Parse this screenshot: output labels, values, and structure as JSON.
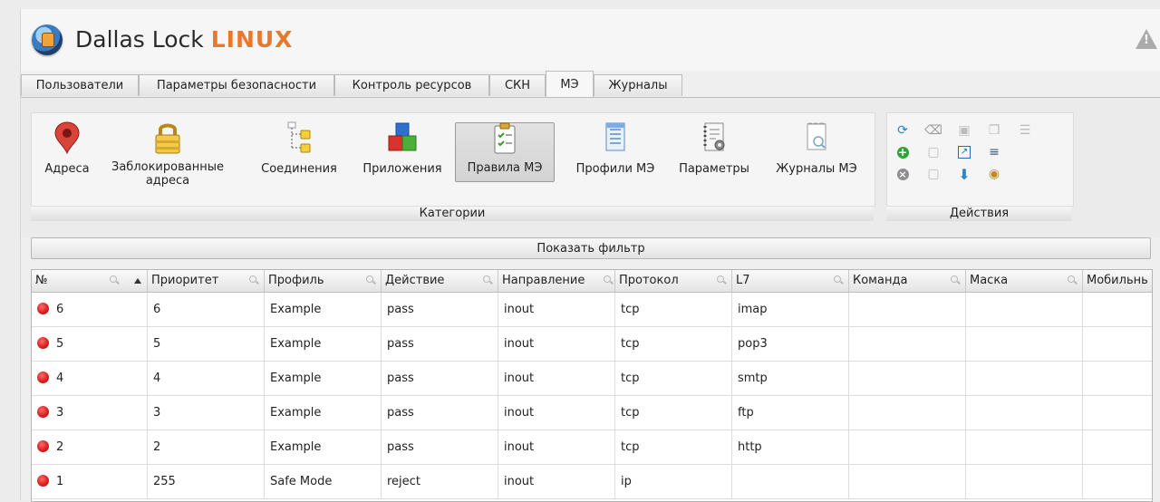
{
  "app": {
    "name_prefix": "Dallas Lock ",
    "name_accent": "LINUX"
  },
  "tabs": [
    "Пользователи",
    "Параметры безопасности",
    "Контроль ресурсов",
    "СКН",
    "МЭ",
    "Журналы"
  ],
  "active_tab": "МЭ",
  "categories": {
    "caption": "Категории",
    "items": [
      {
        "label": "Адреса",
        "icon": "map-pin-icon"
      },
      {
        "label": "Заблокированные адреса",
        "icon": "padlock-icon"
      },
      {
        "label": "Соединения",
        "icon": "tree-connections-icon"
      },
      {
        "label": "Приложения",
        "icon": "app-blocks-icon"
      },
      {
        "label": "Правила МЭ",
        "icon": "clipboard-check-icon"
      },
      {
        "label": "Профили МЭ",
        "icon": "document-icon"
      },
      {
        "label": "Параметры",
        "icon": "settings-notebook-icon"
      },
      {
        "label": "Журналы МЭ",
        "icon": "log-search-icon"
      }
    ],
    "active": "Правила МЭ"
  },
  "actions": {
    "caption": "Действия",
    "icons": [
      "refresh-icon",
      "backspace-icon",
      "save-icon",
      "copy-icon",
      "indent-icon",
      "add-icon",
      "paste-icon",
      "open-link-icon",
      "list-icon",
      "delete-icon",
      "page-icon",
      "move-down-icon",
      "view-icon"
    ]
  },
  "filter_button": "Показать фильтр",
  "table": {
    "columns": [
      "№",
      "Приоритет",
      "Профиль",
      "Действие",
      "Направление",
      "Протокол",
      "L7",
      "Команда",
      "Маска",
      "Мобильнь"
    ],
    "rows": [
      [
        "6",
        "6",
        "Example",
        "pass",
        "inout",
        "tcp",
        "imap"
      ],
      [
        "5",
        "5",
        "Example",
        "pass",
        "inout",
        "tcp",
        "pop3"
      ],
      [
        "4",
        "4",
        "Example",
        "pass",
        "inout",
        "tcp",
        "smtp"
      ],
      [
        "3",
        "3",
        "Example",
        "pass",
        "inout",
        "tcp",
        "ftp"
      ],
      [
        "2",
        "2",
        "Example",
        "pass",
        "inout",
        "tcp",
        "http"
      ],
      [
        "1",
        "255",
        "Safe Mode",
        "reject",
        "inout",
        "ip",
        ""
      ]
    ]
  },
  "colors": {
    "accent": "#e8792b",
    "status_dot": "#d61c1c"
  }
}
